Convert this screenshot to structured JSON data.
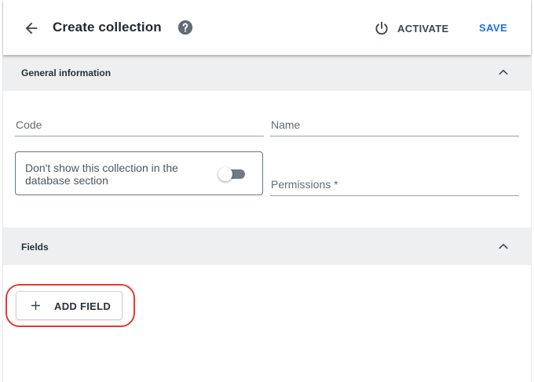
{
  "header": {
    "title": "Create collection",
    "back_icon": "arrow-left-icon",
    "help_icon": "help-circle-icon",
    "activate_label": "ACTIVATE",
    "activate_icon": "power-icon",
    "save_label": "SAVE",
    "accent_color": "#1a73e8"
  },
  "general_section": {
    "label": "General information",
    "expanded": true,
    "chevron_icon": "chevron-up-icon",
    "code_placeholder": "Code",
    "name_placeholder": "Name",
    "toggle_label": "Don't show this collection in the database section",
    "toggle_on": false,
    "permissions_placeholder": "Permissions *"
  },
  "fields_section": {
    "label": "Fields",
    "expanded": true,
    "chevron_icon": "chevron-up-icon",
    "add_field_label": "ADD FIELD",
    "add_icon": "plus-icon",
    "highlight_color": "#e53935"
  }
}
